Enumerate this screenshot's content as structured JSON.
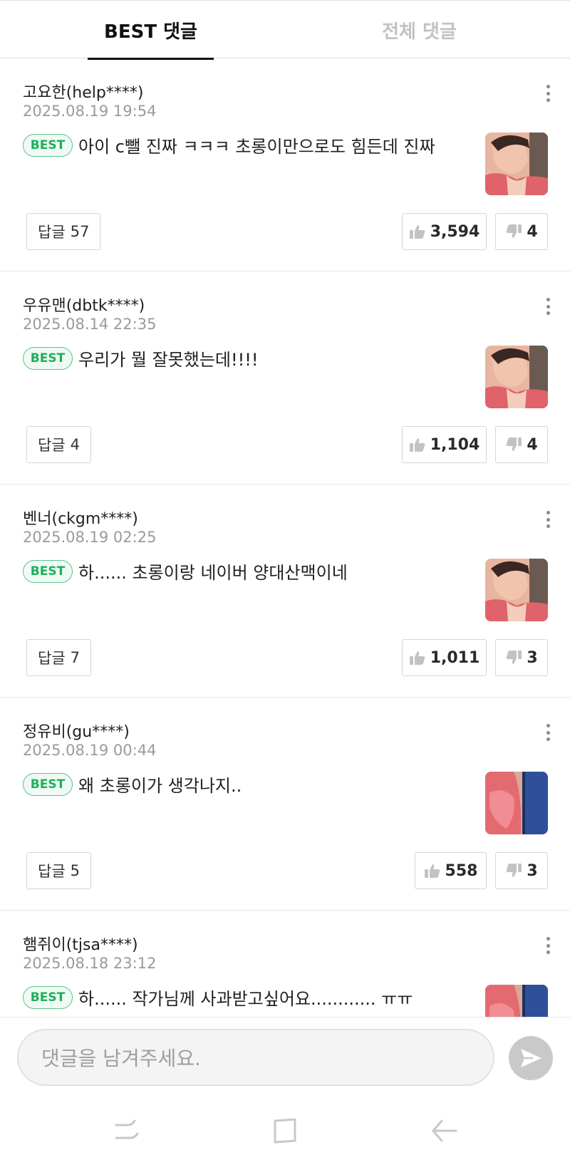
{
  "tabs": [
    {
      "label": "BEST 댓글"
    },
    {
      "label": "전체 댓글"
    }
  ],
  "badge_label": "BEST",
  "reply_label": "답글",
  "comments": [
    {
      "author": "고요한(help****)",
      "date": "2025.08.19 19:54",
      "text": "아이 c뺄 진짜 ㅋㅋㅋ 초롱이만으로도 힘든데 진짜",
      "replies": "57",
      "likes": "3,594",
      "dislikes": "4"
    },
    {
      "author": "우유맨(dbtk****)",
      "date": "2025.08.14 22:35",
      "text": "우리가 뭘 잘못했는데!!!!",
      "replies": "4",
      "likes": "1,104",
      "dislikes": "4"
    },
    {
      "author": "벤너(ckgm****)",
      "date": "2025.08.19 02:25",
      "text": "하...... 초롱이랑 네이버 양대산맥이네",
      "replies": "7",
      "likes": "1,011",
      "dislikes": "3"
    },
    {
      "author": "정유비(gu****)",
      "date": "2025.08.19 00:44",
      "text": "왜 초롱이가 생각나지..",
      "replies": "5",
      "likes": "558",
      "dislikes": "3"
    },
    {
      "author": "햄쥐이(tjsa****)",
      "date": "2025.08.18 23:12",
      "text": "하...... 작가님께 사과받고싶어요............ ㅠㅠ",
      "replies": "",
      "likes": "",
      "dislikes": ""
    }
  ],
  "input": {
    "placeholder": "댓글을 남겨주세요."
  },
  "colors": {
    "best_badge": "#1fae5b",
    "send_button": "#c9c9c9",
    "date_text": "#9a9a9a"
  }
}
